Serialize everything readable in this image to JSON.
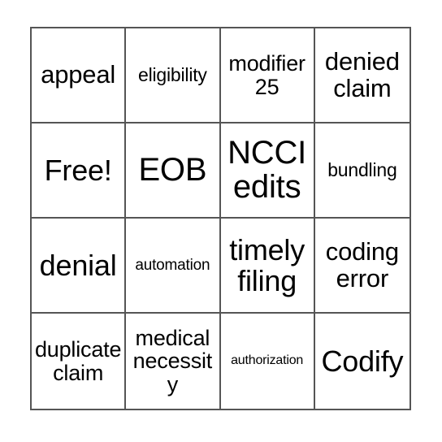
{
  "card": {
    "type": "bingo-card",
    "columns": 4,
    "rows": 4,
    "background_color": "#ffffff",
    "border_color": "#555555",
    "text_color": "#000000",
    "free_space_label": "Free!",
    "cells": [
      {
        "label": "appeal",
        "size": "lg",
        "row": 1,
        "col": 1
      },
      {
        "label": "eligibility",
        "size": "sm",
        "row": 1,
        "col": 2
      },
      {
        "label": "modifier 25",
        "size": "md",
        "row": 1,
        "col": 3
      },
      {
        "label": "denied claim",
        "size": "lg",
        "row": 1,
        "col": 4
      },
      {
        "label": "Free!",
        "size": "xl",
        "row": 2,
        "col": 1
      },
      {
        "label": "EOB",
        "size": "xxl",
        "row": 2,
        "col": 2
      },
      {
        "label": "NCCI edits",
        "size": "xxl",
        "row": 2,
        "col": 3
      },
      {
        "label": "bundling",
        "size": "sm",
        "row": 2,
        "col": 4
      },
      {
        "label": "denial",
        "size": "xl",
        "row": 3,
        "col": 1
      },
      {
        "label": "automation",
        "size": "xs",
        "row": 3,
        "col": 2
      },
      {
        "label": "timely filing",
        "size": "xl",
        "row": 3,
        "col": 3
      },
      {
        "label": "coding error",
        "size": "lg",
        "row": 3,
        "col": 4
      },
      {
        "label": "duplicate claim",
        "size": "md",
        "row": 4,
        "col": 1
      },
      {
        "label": "medical necessity",
        "size": "md",
        "row": 4,
        "col": 2
      },
      {
        "label": "authorization",
        "size": "xxs",
        "row": 4,
        "col": 3
      },
      {
        "label": "Codify",
        "size": "xl",
        "row": 4,
        "col": 4
      }
    ]
  }
}
